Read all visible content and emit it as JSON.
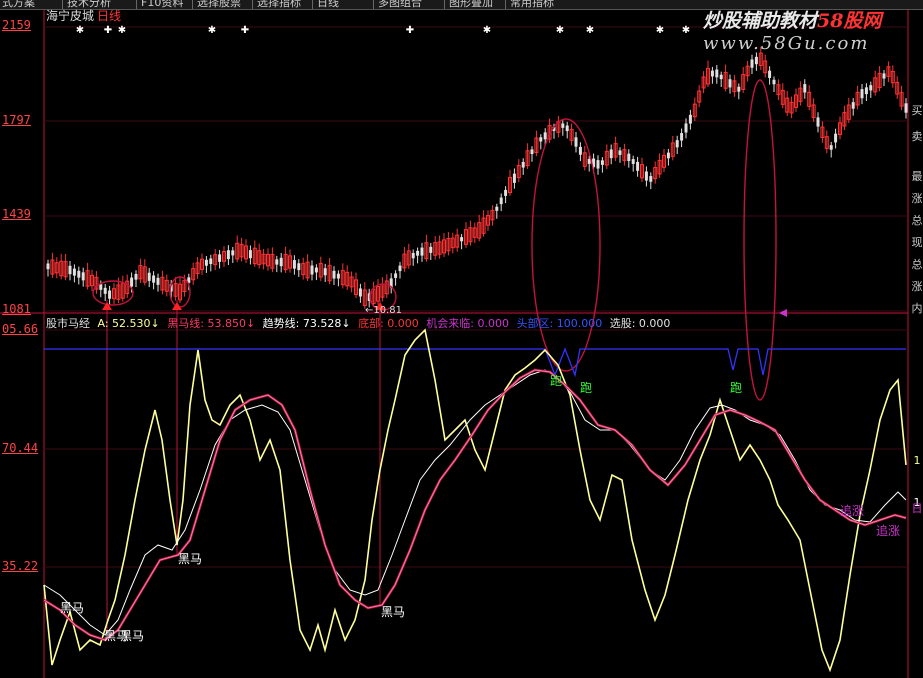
{
  "menu": {
    "items": [
      "式方案",
      "技术分析",
      "F10资料",
      "选择股票",
      "选择指标",
      "日线",
      "多图组合",
      "图形叠加",
      "常用指标"
    ]
  },
  "header": {
    "stock_name": "海宁皮城",
    "period": "日线"
  },
  "watermark": {
    "text_main": "炒股辅助教材",
    "text_accent": "58股网",
    "url": "www.58Gu.com"
  },
  "price_axis": {
    "labels": [
      "2159",
      "1797",
      "1439",
      "1081"
    ]
  },
  "indicator_axis": {
    "labels": [
      "05.66",
      "70.44",
      "35.22"
    ]
  },
  "low_price_label": "←10.81",
  "indicator": {
    "name": "股市马经",
    "a_label": "A: 52.530↓",
    "black_horse_line": "黑马线: 53.850↓",
    "trend_line": "趋势线: 73.528↓",
    "low_point": "底部: 0.000",
    "opportunity": "机会来临: 0.000",
    "top": "头部区: 100.000",
    "selection": "选股: 0.000"
  },
  "markers": {
    "black_horse": "黑马",
    "run": "跑",
    "chase": "追涨"
  },
  "right_column": {
    "chars": [
      "买",
      "卖",
      "最",
      "涨",
      "总",
      "现",
      "总",
      "涨",
      "内"
    ],
    "nums": [
      "1",
      "1",
      "日"
    ]
  },
  "colors": {
    "yellow_line": "#ffff99",
    "white_line": "#ffffff",
    "red_line": "#ff3b66",
    "blue_line": "#3333ff",
    "axis_red": "#ff4444",
    "circle": "#c0143c",
    "candle_up": "#ff3333",
    "candle_down": "#e0e0e0"
  }
}
